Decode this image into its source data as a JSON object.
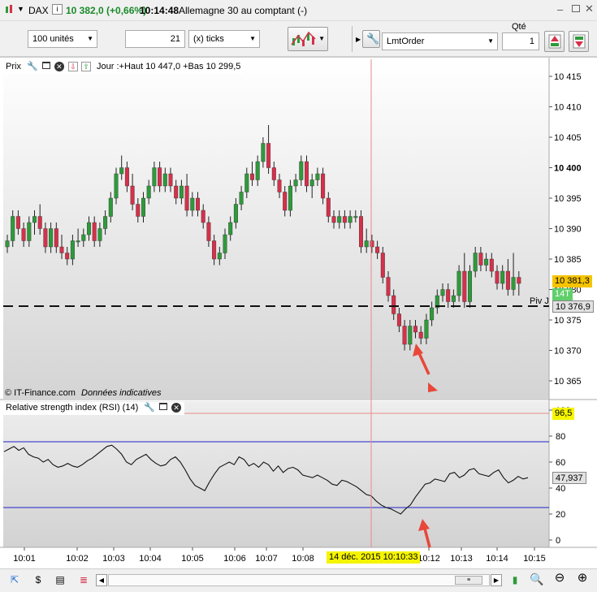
{
  "window": {
    "instrument": "DAX",
    "price_change": "10 382,0 (+0,66%)",
    "time": "10:14:48",
    "description": "Allemagne 30 au comptant (-)"
  },
  "toolbar": {
    "units_select": "100 unités",
    "ticks_value": "21",
    "ticks_unit": "(x) ticks",
    "order_type": "LmtOrder",
    "qty_label": "Qté",
    "qty_value": "1"
  },
  "price_panel": {
    "title": "Prix",
    "info": "Jour :+Haut 10 447,0 +Bas 10 299,5",
    "watermark_source": "© IT-Finance.com",
    "watermark_note": "Données indicatives",
    "current_price": "10 381,3",
    "timer_badge": "14T",
    "pivot_label": "Piv J",
    "pivot_price": "10 376,9",
    "y_ticks": [
      "10 415",
      "10 410",
      "10 405",
      "10 400",
      "10 395",
      "10 390",
      "10 385",
      "10 380",
      "10 375",
      "10 370",
      "10 365"
    ]
  },
  "rsi_panel": {
    "title": "Relative strength index (RSI) (14)",
    "current_value": "47,937",
    "cursor_value": "96,5",
    "y_ticks": [
      "100",
      "80",
      "60",
      "40",
      "20",
      "0"
    ]
  },
  "time_axis": {
    "ticks": [
      "10:01",
      "10:02",
      "10:03",
      "10:04",
      "10:05",
      "10:06",
      "10:07",
      "10:08",
      "10:12",
      "10:13",
      "10:14",
      "10:15"
    ],
    "cursor_label": "14 déc. 2015 10:10:33"
  },
  "colors": {
    "up": "#2e9a3a",
    "down": "#d6304a",
    "cursor": "#e88a8a",
    "rsi_band": "#2020cc",
    "price_chip": "#f5c400",
    "badge": "#5fcf6a",
    "arrow": "#e8473a"
  },
  "chart_data": [
    {
      "type": "candlestick",
      "title": "Prix",
      "ylim": [
        10362,
        10418
      ],
      "ohlc": [
        [
          10387,
          10389,
          10386,
          10388
        ],
        [
          10388,
          10393,
          10387,
          10392
        ],
        [
          10392,
          10393,
          10389,
          10390
        ],
        [
          10390,
          10391,
          10387,
          10388
        ],
        [
          10388,
          10392,
          10387,
          10391
        ],
        [
          10391,
          10393,
          10389,
          10392
        ],
        [
          10392,
          10394,
          10389,
          10390
        ],
        [
          10390,
          10391,
          10386,
          10387
        ],
        [
          10387,
          10391,
          10386,
          10390
        ],
        [
          10390,
          10391,
          10386,
          10387
        ],
        [
          10387,
          10389,
          10385,
          10386
        ],
        [
          10386,
          10387,
          10384,
          10385
        ],
        [
          10385,
          10389,
          10384,
          10388
        ],
        [
          10388,
          10390,
          10387,
          10388
        ],
        [
          10388,
          10390,
          10387,
          10389
        ],
        [
          10389,
          10392,
          10388,
          10391
        ],
        [
          10391,
          10392,
          10387,
          10388
        ],
        [
          10388,
          10391,
          10387,
          10390
        ],
        [
          10390,
          10393,
          10389,
          10392
        ],
        [
          10392,
          10396,
          10391,
          10395
        ],
        [
          10395,
          10400,
          10394,
          10399
        ],
        [
          10399,
          10402,
          10398,
          10400
        ],
        [
          10400,
          10401,
          10396,
          10397
        ],
        [
          10397,
          10399,
          10393,
          10394
        ],
        [
          10394,
          10395,
          10391,
          10392
        ],
        [
          10392,
          10396,
          10391,
          10395
        ],
        [
          10395,
          10398,
          10394,
          10397
        ],
        [
          10397,
          10401,
          10396,
          10400
        ],
        [
          10400,
          10401,
          10396,
          10397
        ],
        [
          10397,
          10400,
          10396,
          10399
        ],
        [
          10399,
          10400,
          10396,
          10397
        ],
        [
          10397,
          10398,
          10394,
          10395
        ],
        [
          10395,
          10398,
          10394,
          10397
        ],
        [
          10397,
          10399,
          10392,
          10393
        ],
        [
          10393,
          10396,
          10392,
          10395
        ],
        [
          10395,
          10396,
          10392,
          10393
        ],
        [
          10393,
          10394,
          10390,
          10391
        ],
        [
          10391,
          10392,
          10387,
          10388
        ],
        [
          10388,
          10389,
          10384,
          10385
        ],
        [
          10385,
          10387,
          10384,
          10386
        ],
        [
          10386,
          10390,
          10385,
          10389
        ],
        [
          10389,
          10392,
          10388,
          10391
        ],
        [
          10391,
          10395,
          10390,
          10394
        ],
        [
          10394,
          10397,
          10393,
          10396
        ],
        [
          10396,
          10400,
          10395,
          10399
        ],
        [
          10399,
          10401,
          10397,
          10398
        ],
        [
          10398,
          10402,
          10397,
          10401
        ],
        [
          10401,
          10405,
          10400,
          10404
        ],
        [
          10404,
          10407,
          10399,
          10400
        ],
        [
          10400,
          10401,
          10397,
          10398
        ],
        [
          10398,
          10399,
          10395,
          10396
        ],
        [
          10396,
          10397,
          10392,
          10393
        ],
        [
          10393,
          10398,
          10392,
          10397
        ],
        [
          10397,
          10399,
          10396,
          10398
        ],
        [
          10398,
          10402,
          10397,
          10401
        ],
        [
          10401,
          10402,
          10396,
          10397
        ],
        [
          10397,
          10399,
          10395,
          10398
        ],
        [
          10398,
          10400,
          10397,
          10399
        ],
        [
          10399,
          10400,
          10394,
          10395
        ],
        [
          10395,
          10396,
          10391,
          10392
        ],
        [
          10392,
          10393,
          10390,
          10391
        ],
        [
          10391,
          10393,
          10390,
          10392
        ],
        [
          10392,
          10393,
          10390,
          10391
        ],
        [
          10391,
          10393,
          10390,
          10392
        ],
        [
          10392,
          10393,
          10391,
          10392
        ],
        [
          10392,
          10393,
          10386,
          10387
        ],
        [
          10387,
          10390,
          10386,
          10388
        ],
        [
          10388,
          10389,
          10386,
          10387
        ],
        [
          10387,
          10388,
          10385,
          10386
        ],
        [
          10386,
          10387,
          10381,
          10382
        ],
        [
          10382,
          10383,
          10378,
          10379
        ],
        [
          10379,
          10380,
          10375,
          10376
        ],
        [
          10376,
          10377,
          10373,
          10374
        ],
        [
          10374,
          10375,
          10370,
          10371
        ],
        [
          10371,
          10375,
          10370,
          10374
        ],
        [
          10374,
          10375,
          10372,
          10373
        ],
        [
          10373,
          10374,
          10371,
          10372
        ],
        [
          10372,
          10376,
          10371,
          10375
        ],
        [
          10375,
          10378,
          10374,
          10377
        ],
        [
          10377,
          10380,
          10376,
          10379
        ],
        [
          10379,
          10381,
          10378,
          10380
        ],
        [
          10380,
          10381,
          10377,
          10378
        ],
        [
          10378,
          10380,
          10377,
          10379
        ],
        [
          10379,
          10384,
          10378,
          10383
        ],
        [
          10383,
          10386,
          10377,
          10378
        ],
        [
          10378,
          10384,
          10377,
          10383
        ],
        [
          10383,
          10387,
          10382,
          10386
        ],
        [
          10386,
          10387,
          10383,
          10384
        ],
        [
          10384,
          10386,
          10383,
          10385
        ],
        [
          10385,
          10386,
          10382,
          10383
        ],
        [
          10383,
          10384,
          10380,
          10381
        ],
        [
          10381,
          10384,
          10380,
          10383
        ],
        [
          10383,
          10385,
          10379,
          10380
        ],
        [
          10380,
          10386,
          10379,
          10382
        ],
        [
          10382,
          10383,
          10379,
          10381
        ]
      ]
    },
    {
      "type": "line",
      "title": "Relative strength index (RSI) (14)",
      "ylim": [
        0,
        100
      ],
      "bands": [
        75,
        25
      ],
      "series": [
        {
          "values": [
            68,
            70,
            72,
            69,
            71,
            66,
            64,
            63,
            60,
            62,
            58,
            56,
            57,
            59,
            57,
            56,
            58,
            61,
            63,
            66,
            69,
            72,
            73,
            70,
            66,
            60,
            58,
            62,
            64,
            66,
            62,
            59,
            57,
            58,
            62,
            64,
            60,
            54,
            47,
            42,
            40,
            38,
            45,
            51,
            56,
            58,
            60,
            58,
            64,
            62,
            57,
            59,
            56,
            60,
            58,
            53,
            57,
            52,
            55,
            56,
            54,
            50,
            49,
            48,
            50,
            48,
            46,
            43,
            42,
            46,
            45,
            43,
            41,
            38,
            35,
            34,
            30,
            27,
            25,
            24,
            22,
            20,
            24,
            27,
            33,
            38,
            43,
            44,
            47,
            46,
            45,
            51,
            52,
            48,
            50,
            54,
            55,
            51,
            50,
            49,
            52,
            54,
            48,
            44,
            46,
            49,
            47,
            48
          ]
        }
      ]
    }
  ]
}
